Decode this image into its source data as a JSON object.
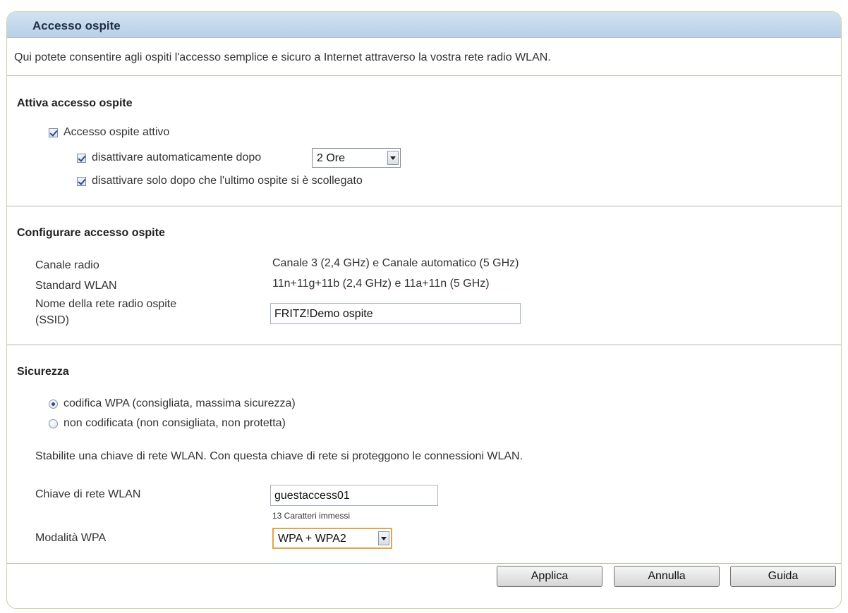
{
  "panel": {
    "title": "Accesso ospite",
    "intro": "Qui potete consentire agli ospiti l'accesso semplice e sicuro a Internet attraverso la vostra rete radio WLAN."
  },
  "activate": {
    "section_title": "Attiva accesso ospite",
    "guest_access_active": {
      "label": "Accesso ospite attivo",
      "checked": true
    },
    "auto_disable": {
      "label": "disattivare automaticamente dopo",
      "checked": true
    },
    "auto_disable_duration": {
      "selected": "2 Ore"
    },
    "disable_after_last": {
      "label": "disattivare solo dopo che l'ultimo ospite si è scollegato",
      "checked": true
    }
  },
  "configure": {
    "section_title": "Configurare accesso ospite",
    "channel_label": "Canale radio",
    "channel_value": "Canale 3 (2,4 GHz) e Canale automatico (5 GHz)",
    "standard_label": "Standard WLAN",
    "standard_value": "11n+11g+11b (2,4 GHz) e 11a+11n (5 GHz)",
    "ssid_label_line1": "Nome della rete radio ospite",
    "ssid_label_line2": "(SSID)",
    "ssid_value": "FRITZ!Demo ospite"
  },
  "security": {
    "section_title": "Sicurezza",
    "option_wpa": {
      "label": "codifica WPA (consigliata, massima sicurezza)",
      "selected": true
    },
    "option_none": {
      "label": "non codificata (non consigliata, non protetta)",
      "selected": false
    },
    "hint": "Stabilite una chiave di rete WLAN. Con questa chiave di rete si proteggono le connessioni WLAN.",
    "key_label": "Chiave di rete WLAN",
    "key_value": "guestaccess01",
    "key_counter": "13 Caratteri immessi",
    "mode_label": "Modalità WPA",
    "mode_selected": "WPA + WPA2"
  },
  "footer": {
    "apply_label": "Applica",
    "cancel_label": "Annulla",
    "help_label": "Guida"
  }
}
